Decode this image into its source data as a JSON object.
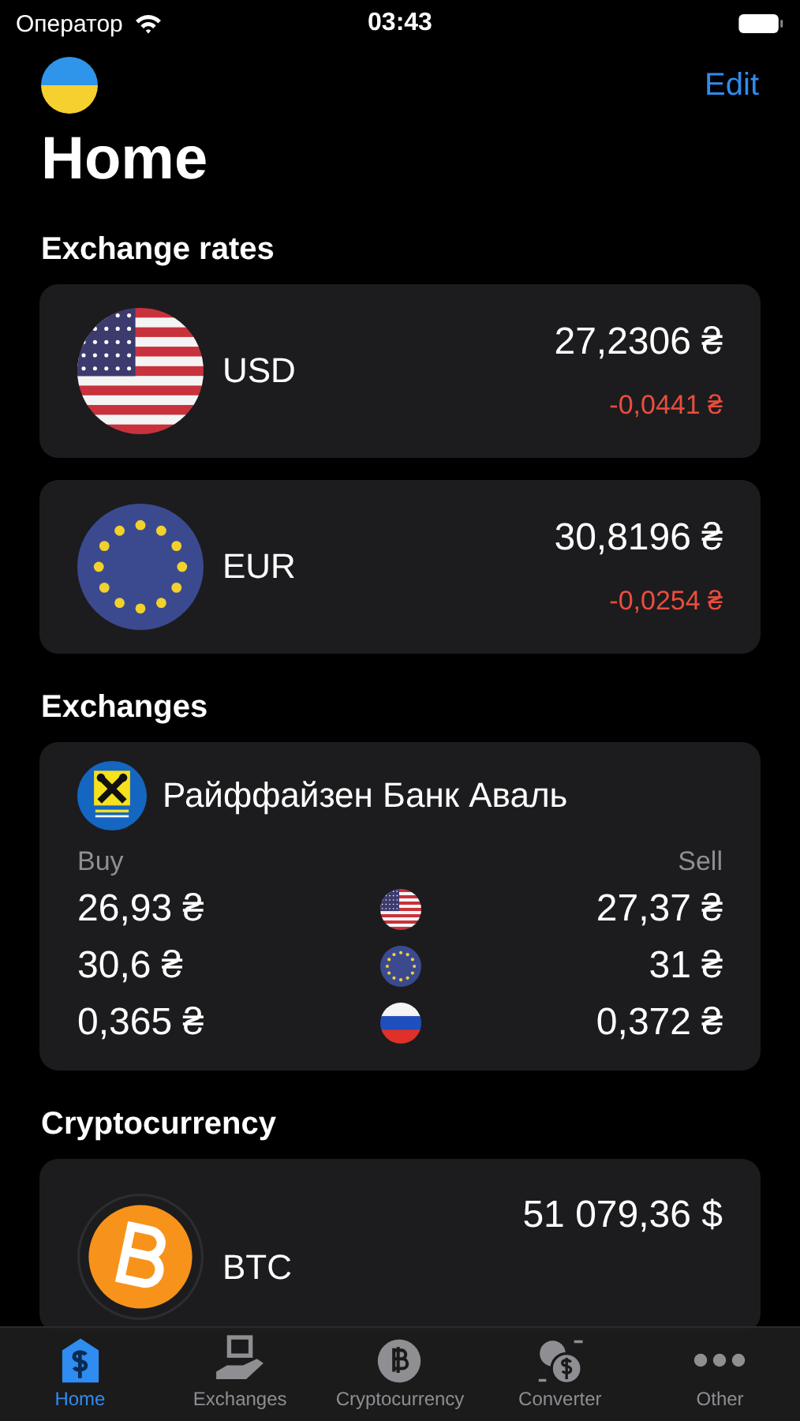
{
  "status_bar": {
    "carrier": "Оператор",
    "time": "03:43"
  },
  "nav": {
    "edit": "Edit"
  },
  "title": "Home",
  "exchange_rates": {
    "heading": "Exchange rates",
    "items": [
      {
        "kind": "us",
        "currency": "USD",
        "rate": "27,2306 ₴",
        "change": "-0,0441 ₴"
      },
      {
        "kind": "eu",
        "currency": "EUR",
        "rate": "30,8196 ₴",
        "change": "-0,0254 ₴"
      }
    ]
  },
  "exchanges": {
    "heading": "Exchanges",
    "banks": [
      {
        "name": "Райффайзен Банк Аваль",
        "buy_label": "Buy",
        "sell_label": "Sell",
        "rows": [
          {
            "kind": "us",
            "buy": "26,93 ₴",
            "sell": "27,37 ₴"
          },
          {
            "kind": "eu",
            "buy": "30,6 ₴",
            "sell": "31 ₴"
          },
          {
            "kind": "ru",
            "buy": "0,365 ₴",
            "sell": "0,372 ₴"
          }
        ]
      }
    ]
  },
  "cryptocurrency": {
    "heading": "Cryptocurrency",
    "items": [
      {
        "kind": "btc",
        "code": "BTC",
        "price": "51 079,36 $"
      }
    ]
  },
  "tabs": [
    {
      "kind": "home",
      "label": "Home",
      "selected": true
    },
    {
      "kind": "exchanges",
      "label": "Exchanges",
      "selected": false
    },
    {
      "kind": "crypto",
      "label": "Cryptocurrency",
      "selected": false
    },
    {
      "kind": "converter",
      "label": "Converter",
      "selected": false
    },
    {
      "kind": "other",
      "label": "Other",
      "selected": false
    }
  ]
}
